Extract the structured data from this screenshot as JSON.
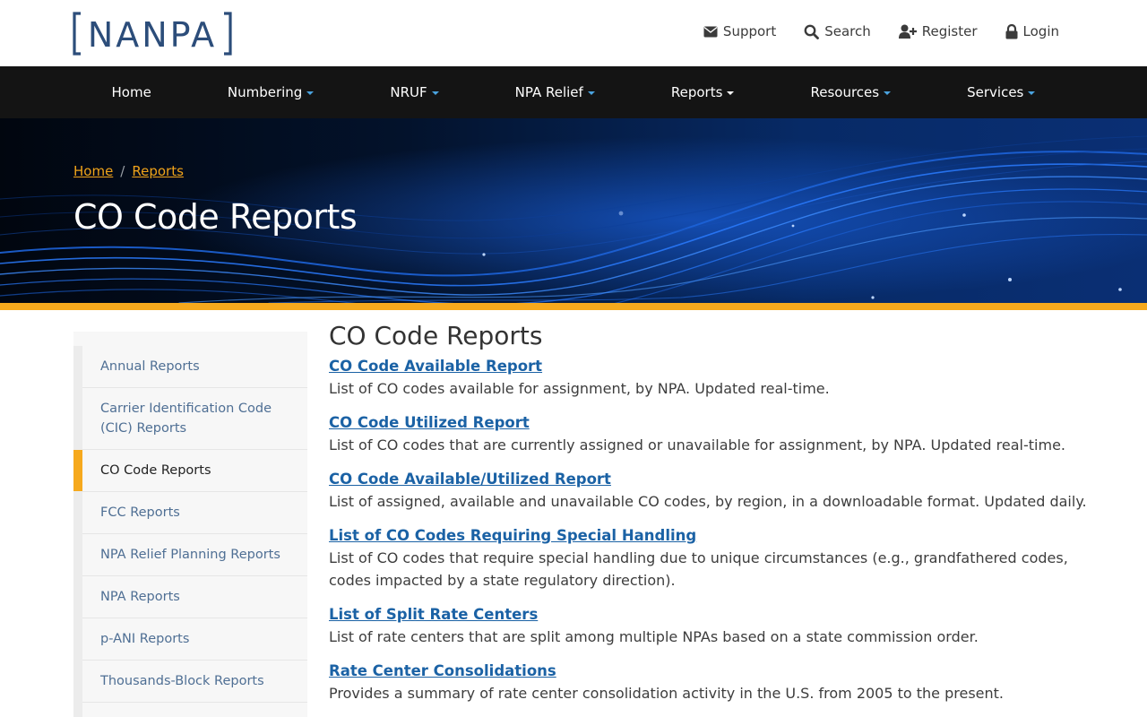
{
  "brand": {
    "logo_text": "NANPA",
    "logo_color": "#2c4d7a"
  },
  "utility_nav": [
    {
      "label": "Support",
      "icon": "envelope-icon"
    },
    {
      "label": "Search",
      "icon": "search-icon"
    },
    {
      "label": "Register",
      "icon": "user-plus-icon"
    },
    {
      "label": "Login",
      "icon": "lock-icon"
    }
  ],
  "main_nav": [
    {
      "label": "Home",
      "dropdown": false
    },
    {
      "label": "Numbering",
      "dropdown": true
    },
    {
      "label": "NRUF",
      "dropdown": true
    },
    {
      "label": "NPA Relief",
      "dropdown": true
    },
    {
      "label": "Reports",
      "dropdown": true
    },
    {
      "label": "Resources",
      "dropdown": true
    },
    {
      "label": "Services",
      "dropdown": true
    }
  ],
  "breadcrumb": {
    "home": "Home",
    "separator": "/",
    "parent": "Reports"
  },
  "hero": {
    "title": "CO Code Reports"
  },
  "sidebar": {
    "items": [
      {
        "label": "Annual Reports",
        "active": false
      },
      {
        "label": "Carrier Identification Code (CIC) Reports",
        "active": false
      },
      {
        "label": "CO Code Reports",
        "active": true
      },
      {
        "label": "FCC Reports",
        "active": false
      },
      {
        "label": "NPA Relief Planning Reports",
        "active": false
      },
      {
        "label": "NPA Reports",
        "active": false
      },
      {
        "label": "p-ANI Reports",
        "active": false
      },
      {
        "label": "Thousands-Block Reports",
        "active": false
      }
    ]
  },
  "main": {
    "title": "CO Code Reports",
    "reports": [
      {
        "title": "CO Code Available Report",
        "description": "List of CO codes available for assignment, by NPA. Updated real-time."
      },
      {
        "title": "CO Code Utilized Report",
        "description": "List of CO codes that are currently assigned or unavailable for assignment, by NPA. Updated real-time."
      },
      {
        "title": "CO Code Available/Utilized Report",
        "description": "List of assigned, available and unavailable CO codes, by region, in a downloadable format. Updated daily."
      },
      {
        "title": "List of CO Codes Requiring Special Handling",
        "description": "List of CO codes that require special handling due to unique circumstances (e.g., grandfathered codes, codes impacted by a state regulatory direction)."
      },
      {
        "title": "List of Split Rate Centers",
        "description": "List of rate centers that are split among multiple NPAs based on a state commission order."
      },
      {
        "title": "Rate Center Consolidations",
        "description": "Provides a summary of rate center consolidation activity in the U.S. from 2005 to the present."
      }
    ]
  },
  "colors": {
    "nav_bg": "#141414",
    "accent_orange": "#f6a91d",
    "link_blue": "#1b62a5",
    "sidebar_link": "#4f6f94"
  }
}
